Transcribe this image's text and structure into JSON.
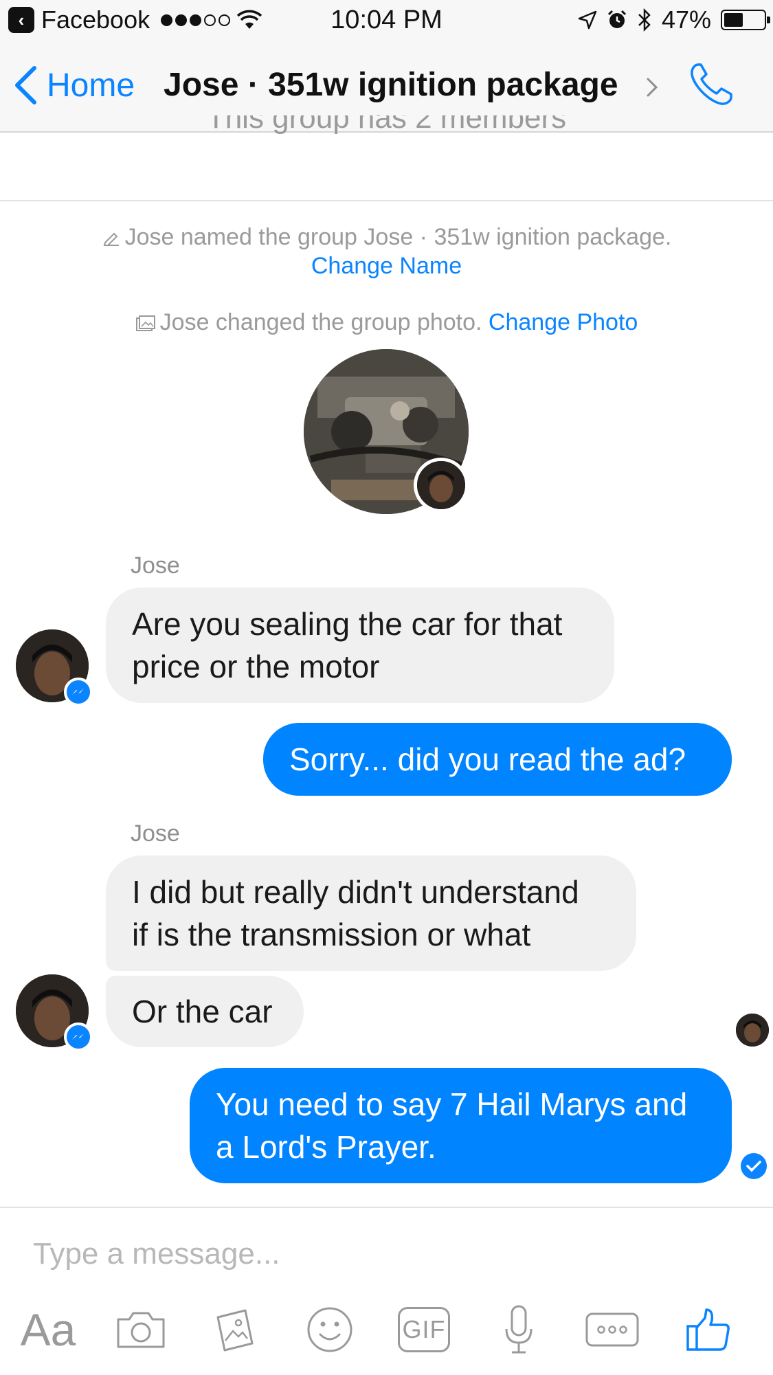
{
  "status_bar": {
    "back_app": "Facebook",
    "time": "10:04 PM",
    "battery": "47%",
    "battery_level": 0.47,
    "signal_bars": 3,
    "signal_total": 5
  },
  "nav": {
    "back_label": "Home",
    "title": "Jose · 351w ignition package"
  },
  "thread": {
    "members_text": "This group has 2 members",
    "rename_event": "Jose named the group Jose · 351w ignition package.",
    "rename_action": "Change Name",
    "photo_event": "Jose changed the group photo.",
    "photo_action": "Change Photo"
  },
  "messages": [
    {
      "sender": "Jose",
      "lines": [
        "Are you sealing the car for that",
        "price or the motor"
      ]
    },
    {
      "lines": [
        "Sorry... did you read the ad?"
      ]
    },
    {
      "sender": "Jose",
      "lines": [
        "I did but really didn't understand",
        "if is the transmission or what"
      ]
    },
    {
      "lines": [
        "Or the car"
      ]
    },
    {
      "lines": [
        "You need to say 7 Hail Marys and",
        "a Lord's Prayer."
      ]
    }
  ],
  "composer": {
    "placeholder": "Type a message..."
  },
  "toolbar": {
    "text_label": "Aa",
    "gif_label": "GIF"
  },
  "colors": {
    "accent": "#0a84ff",
    "outgoing_bubble": "#0084ff",
    "incoming_bubble": "#f0f0f0"
  }
}
